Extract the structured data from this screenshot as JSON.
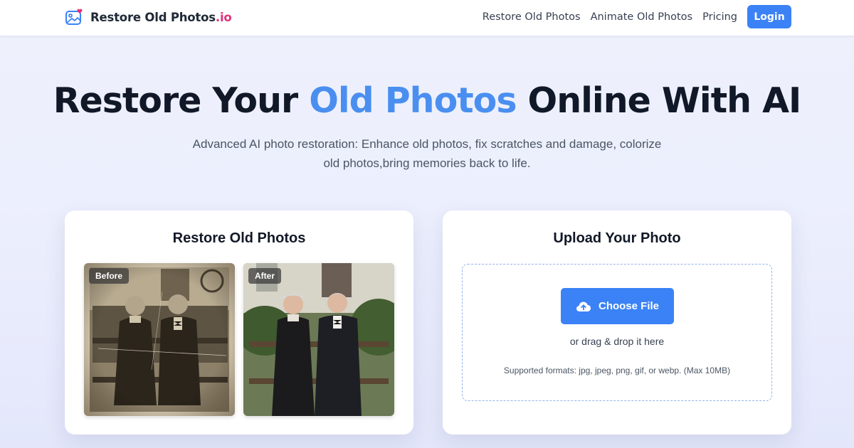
{
  "brand": {
    "name": "Restore Old Photos",
    "suffix": ".io",
    "icon": "photo-heart-icon"
  },
  "nav": {
    "links": [
      "Restore Old Photos",
      "Animate Old Photos",
      "Pricing"
    ],
    "login_label": "Login"
  },
  "hero": {
    "title_before": "Restore Your ",
    "title_accent": "Old Photos",
    "title_after": " Online With AI",
    "subtitle": "Advanced AI photo restoration: Enhance old photos, fix scratches and damage, colorize old photos,bring memories back to life."
  },
  "example_card": {
    "title": "Restore Old Photos",
    "before_label": "Before",
    "after_label": "After"
  },
  "upload_card": {
    "title": "Upload Your Photo",
    "button_label": "Choose File",
    "button_icon": "cloud-upload-icon",
    "drag_text": "or drag & drop it here",
    "formats_text": "Supported formats: jpg, jpeg, png, gif, or webp. (Max 10MB)"
  },
  "colors": {
    "accent": "#3b82f6",
    "title_accent": "#4a8ff0",
    "brand_suffix": "#e0337a",
    "dropzone_border": "#93b4e6"
  }
}
